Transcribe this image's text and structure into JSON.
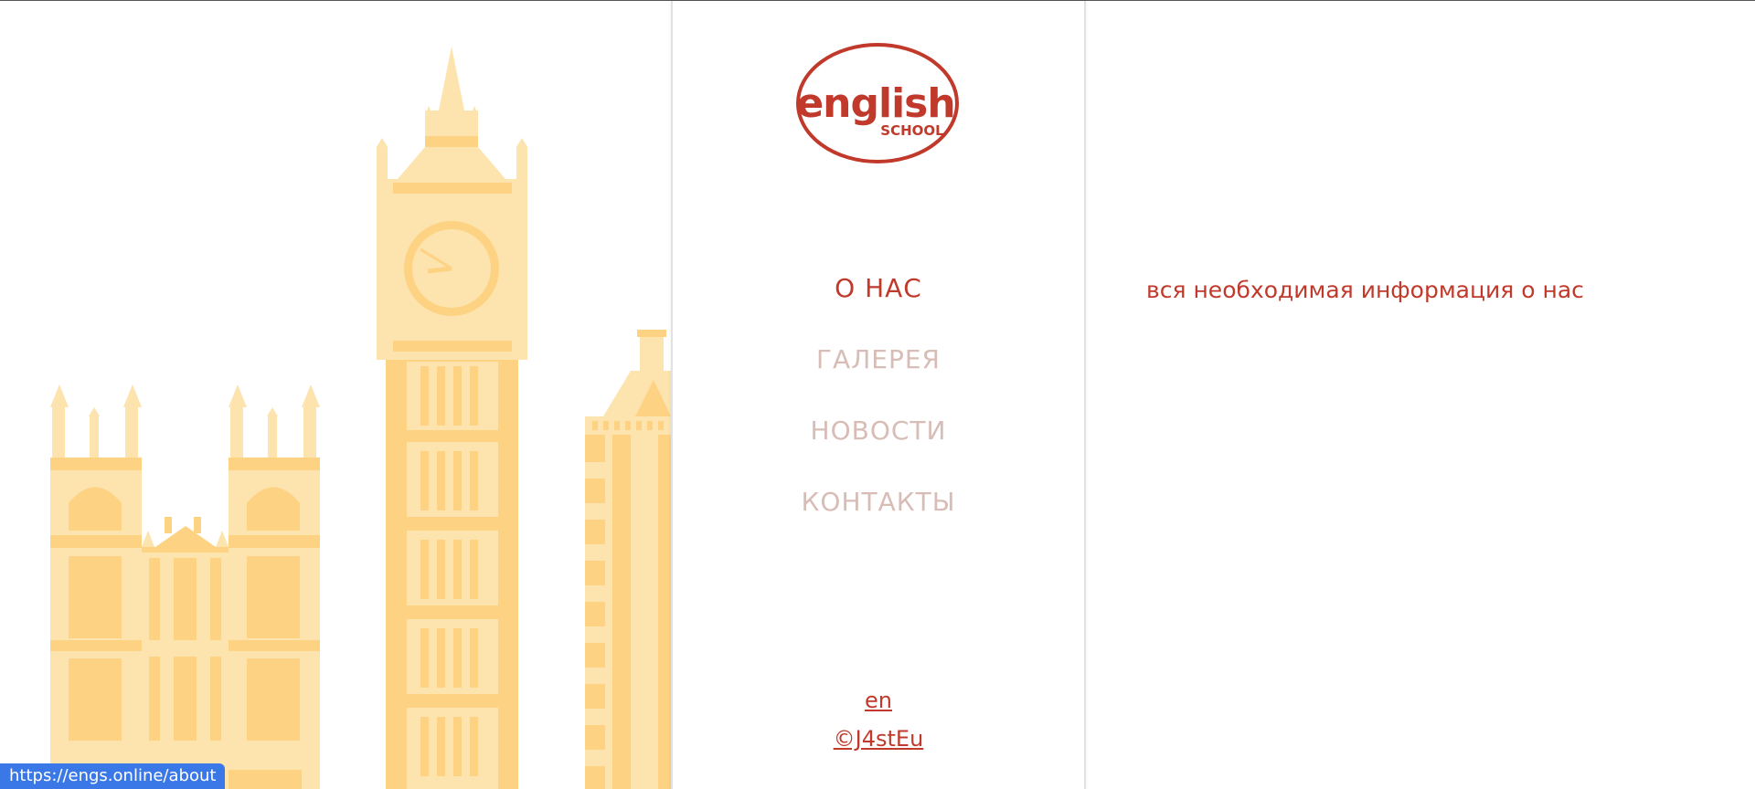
{
  "logo": {
    "word": "english",
    "sub": "SCHOOL"
  },
  "nav": {
    "items": [
      {
        "label": "О НАС",
        "active": true
      },
      {
        "label": "ГАЛЕРЕЯ",
        "active": false
      },
      {
        "label": "НОВОСТИ",
        "active": false
      },
      {
        "label": "КОНТАКТЫ",
        "active": false
      }
    ]
  },
  "footer": {
    "lang_label": "en",
    "credit_label": "©J4stEu"
  },
  "content": {
    "text": "вся необходимая информация о нас"
  },
  "status_bar": {
    "url": "https://engs.online/about"
  },
  "colors": {
    "accent": "#c0392b",
    "nav_inactive": "#d8bcb6",
    "illustration_light": "#fde3ad",
    "illustration_dark": "#fdd283",
    "status_bar": "#3b78e7"
  }
}
